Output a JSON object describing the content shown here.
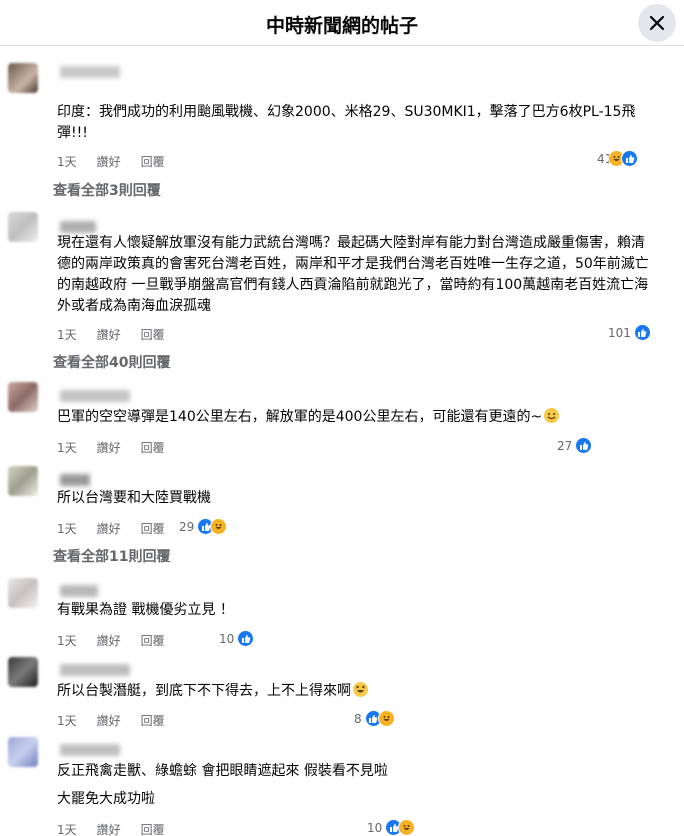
{
  "header": {
    "title": "中時新聞網的帖子"
  },
  "comments": [
    {
      "text": "印度：我們成功的利用颱風戰機、幻象2000、米格29、SU30MKI1，擊落了巴方6枚PL-15飛彈!!!",
      "time": "1天",
      "like": "讚好",
      "reply": "回覆",
      "count": "41",
      "replies": "查看全部3則回覆"
    },
    {
      "text": "現在還有人懷疑解放軍沒有能力武統台灣嗎？最起碼大陸對岸有能力對台灣造成嚴重傷害，賴清德的兩岸政策真的會害死台灣老百姓，兩岸和平才是我們台灣老百姓唯一生存之道，50年前滅亡的南越政府 一旦戰爭崩盤高官們有錢人西貢淪陷前就跑光了，當時約有100萬越南老百姓流亡海外或者成為南海血淚孤魂",
      "time": "1天",
      "like": "讚好",
      "reply": "回覆",
      "count": "101",
      "replies": "查看全部40則回覆"
    },
    {
      "text": "巴軍的空空導彈是140公里左右，解放軍的是400公里左右，可能還有更遠的~",
      "time": "1天",
      "like": "讚好",
      "reply": "回覆",
      "count": "27"
    },
    {
      "text": "所以台灣要和大陸買戰機",
      "time": "1天",
      "like": "讚好",
      "reply": "回覆",
      "count": "29",
      "replies": "查看全部11則回覆"
    },
    {
      "text": "有戰果為證 戰機優劣立見 ！",
      "time": "1天",
      "like": "讚好",
      "reply": "回覆",
      "count": "10"
    },
    {
      "text": "所以台製潛艇，到底下不下得去，上不上得來啊",
      "time": "1天",
      "like": "讚好",
      "reply": "回覆",
      "count": "8"
    },
    {
      "text": "反正飛禽走獸、綠蟾蜍 會把眼睛遮起來 假裝看不見啦",
      "text2": "大罷免大成功啦",
      "time": "1天",
      "like": "讚好",
      "reply": "回覆",
      "count": "10"
    }
  ],
  "icons": {
    "close": "close-icon",
    "like": "like-reaction-icon",
    "haha": "haha-reaction-icon"
  },
  "colors": {
    "like": "#1877f2",
    "haha": "#f7b125",
    "meta": "#65676b"
  }
}
